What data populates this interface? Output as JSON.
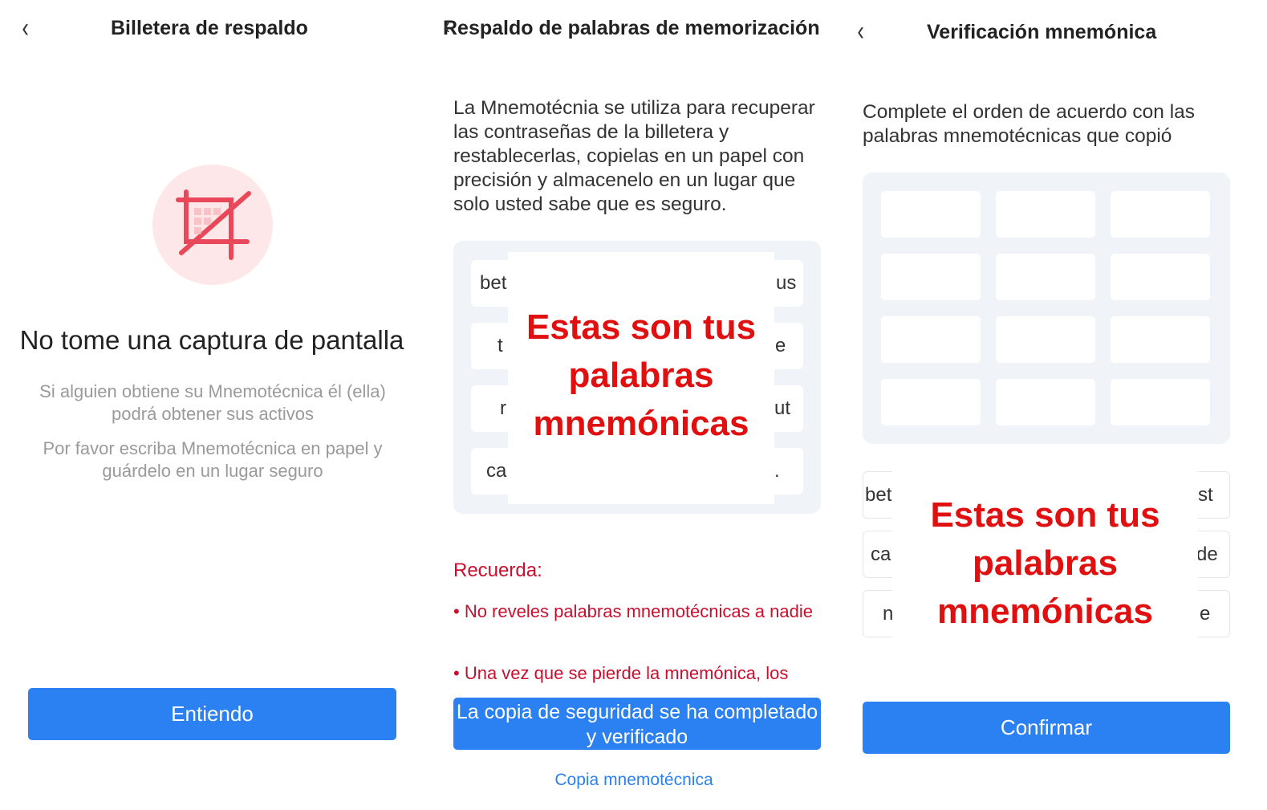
{
  "panel1": {
    "title": "Billetera de respaldo",
    "heading": "No tome una captura de pantalla",
    "note1": "Si alguien obtiene su Mnemotécnica él (ella) podrá obtener sus activos",
    "note2": "Por favor escriba Mnemotécnica en papel y guárdelo en un lugar seguro",
    "button": "Entiendo",
    "icon": "crop-icon",
    "accent": "#e8485a"
  },
  "panel2": {
    "title": "Respaldo de palabras de memorización",
    "description": "La Mnemotécnia se utiliza para recuperar las contraseñas de la billetera y restablecerlas, copielas en un papel con precisión y almacenelo en un lugar que solo usted sabe que es seguro.",
    "words": [
      "bet",
      "us",
      "t",
      "e",
      "r",
      "ut",
      "ca",
      "."
    ],
    "overlay": "Estas son tus palabras mnemónicas",
    "remember": "Recuerda:",
    "warning1": "• No reveles palabras mnemotécnicas a nadie",
    "warning2": "• Una vez que se pierde la mnemónica, los",
    "button": "La copia de seguridad se ha completado y verificado",
    "link": "Copia mnemotécnica"
  },
  "panel3": {
    "title": "Verificación mnemónica",
    "description": "Complete el orden de acuerdo con las palabras mnemotécnicas que copió",
    "words": [
      "bet",
      "st",
      "ca",
      "de",
      "n",
      "e"
    ],
    "overlay": "Estas son tus palabras mnemónicas",
    "button": "Confirmar"
  },
  "colors": {
    "primary": "#2b80f2",
    "warning": "#c8102e",
    "overlay_text": "#e01010"
  }
}
